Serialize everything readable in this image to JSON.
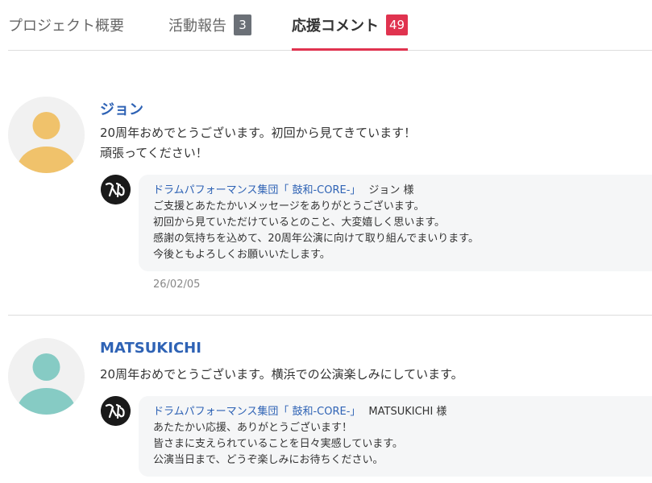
{
  "tabs": [
    {
      "label": "プロジェクト概要"
    },
    {
      "label": "活動報告",
      "badge": "3"
    },
    {
      "label": "応援コメント",
      "badge": "49",
      "active": true
    }
  ],
  "colors": {
    "accent": "#e0334f",
    "link": "#2f63b5",
    "badge_gray": "#6b7077"
  },
  "comments": [
    {
      "name": "ジョン",
      "avatar_color": "#f0c26b",
      "lines": [
        "20周年おめでとうございます。初回から見てきています！",
        "頑張ってください！"
      ],
      "reply": {
        "from": "ドラムパフォーマンス集団「 鼓和-CORE-」",
        "to": "ジョン 様",
        "lines": [
          "ご支援とあたたかいメッセージをありがとうございます。",
          "初回から見ていただけているとのこと、大変嬉しく思います。",
          "感謝の気持ちを込めて、20周年公演に向けて取り組んでまいります。",
          "今後ともよろしくお願いいたします。"
        ]
      },
      "date": "26/02/05"
    },
    {
      "name": "MATSUKICHI",
      "avatar_color": "#86cbc4",
      "lines": [
        "20周年おめでとうございます。横浜での公演楽しみにしています。"
      ],
      "reply": {
        "from": "ドラムパフォーマンス集団「 鼓和-CORE-」",
        "to": "MATSUKICHI 様",
        "lines": [
          "あたたかい応援、ありがとうございます！",
          "皆さまに支えられていることを日々実感しています。",
          "公演当日まで、どうぞ楽しみにお待ちください。"
        ]
      }
    }
  ]
}
